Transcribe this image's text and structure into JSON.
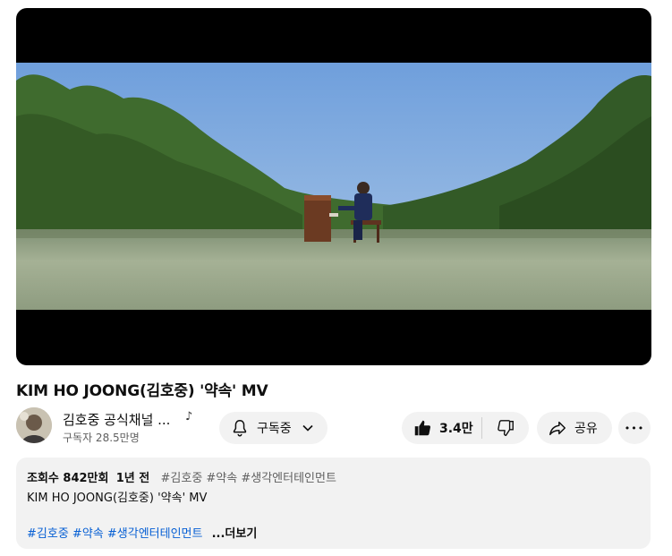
{
  "video": {
    "title": "KIM HO JOONG(김호중) '약속' MV"
  },
  "channel": {
    "name": "김호중 공식채널 ...",
    "badge_icon": "music-note-icon",
    "badge_glyph": "♪",
    "subscribers": "구독자 28.5만명"
  },
  "actions": {
    "subscribe_label": "구독중",
    "like_count": "3.4만",
    "share_label": "공유",
    "more_label": "•••"
  },
  "description": {
    "views": "조회수 842만회",
    "age": "1년 전",
    "tags": "#김호중 #약속 #생각엔터테인먼트",
    "line": "KIM HO JOONG(김호중) '약속' MV",
    "hashtags": [
      "#김호중",
      "#약속",
      "#생각엔터테인먼트"
    ],
    "more_label": "...더보기"
  },
  "colors": {
    "link": "#065fd4",
    "pill_bg": "#f2f2f2",
    "sky": "#8fb4e0",
    "grass": "#9aa98a"
  }
}
